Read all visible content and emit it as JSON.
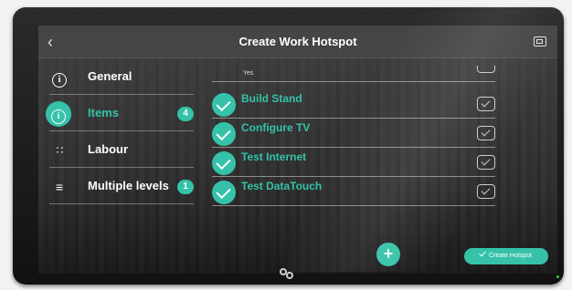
{
  "header": {
    "title": "Create Work Hotspot",
    "back_icon": "chevron-left-icon",
    "window_icon": "window-icon"
  },
  "sidebar": {
    "items": [
      {
        "label": "General",
        "icon": "info-circle-icon",
        "badge": "",
        "active": false
      },
      {
        "label": "Items",
        "icon": "info-circle-icon",
        "badge": "4",
        "active": true
      },
      {
        "label": "Labour",
        "icon": "keypad-icon",
        "badge": "",
        "active": false
      },
      {
        "label": "Multiple levels",
        "icon": "list-icon",
        "badge": "1",
        "active": false
      }
    ]
  },
  "tasks": {
    "partial_label": "Yes",
    "items": [
      {
        "label": "Build Stand",
        "checked": true
      },
      {
        "label": "Configure TV",
        "checked": true
      },
      {
        "label": "Test Internet",
        "checked": true
      },
      {
        "label": "Test DataTouch",
        "checked": true
      }
    ]
  },
  "actions": {
    "add_label": "+",
    "create_label": "Create Hotspot"
  },
  "colors": {
    "accent": "#35c2a8",
    "header_bg": "#464646",
    "text": "#ffffff"
  }
}
